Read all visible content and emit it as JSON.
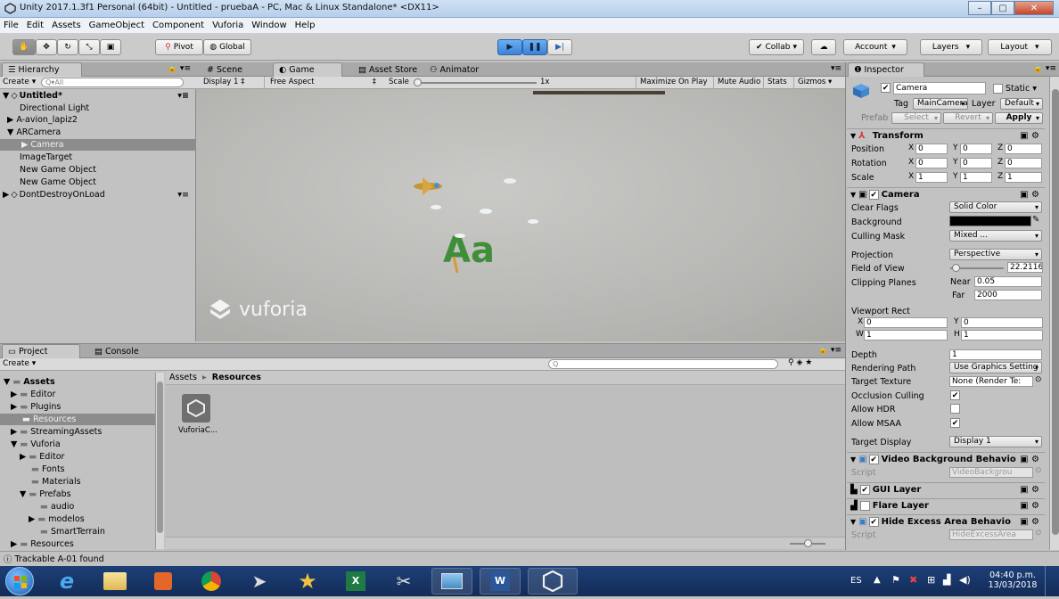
{
  "window": {
    "title": "Unity 2017.1.3f1 Personal (64bit) - Untitled - pruebaA - PC, Mac & Linux Standalone* <DX11>",
    "min": "–",
    "max": "▢",
    "close": "✕"
  },
  "menu": [
    "File",
    "Edit",
    "Assets",
    "GameObject",
    "Component",
    "Vuforia",
    "Window",
    "Help"
  ],
  "toolbar": {
    "pivot": "Pivot",
    "global": "Global",
    "collab": "Collab",
    "account": "Account",
    "layers": "Layers",
    "layout": "Layout"
  },
  "hierarchy": {
    "tab": "Hierarchy",
    "create": "Create",
    "search_placeholder": "Q▾All",
    "scene": "Untitled*",
    "items": [
      "Directional Light",
      "A-avion_lapiz2",
      "ARCamera",
      "Camera",
      "ImageTarget",
      "New Game Object",
      "New Game Object"
    ],
    "dont_destroy": "DontDestroyOnLoad"
  },
  "scene_tabs": {
    "scene": "Scene",
    "game": "Game",
    "asset_store": "Asset Store",
    "animator": "Animator"
  },
  "game_bar": {
    "display": "Display 1",
    "aspect": "Free Aspect",
    "scale_label": "Scale",
    "scale_value": "1x",
    "maximize": "Maximize On Play",
    "mute": "Mute Audio",
    "stats": "Stats",
    "gizmos": "Gizmos"
  },
  "game_view": {
    "logo_text": "vuforia",
    "ar_text": "Aa"
  },
  "project": {
    "tab_project": "Project",
    "tab_console": "Console",
    "create": "Create",
    "tree": [
      "Assets",
      "Editor",
      "Plugins",
      "Resources",
      "StreamingAssets",
      "Vuforia",
      "Editor",
      "Fonts",
      "Materials",
      "Prefabs",
      "audio",
      "modelos",
      "SmartTerrain",
      "Resources"
    ],
    "breadcrumb_root": "Assets",
    "breadcrumb_sep": "▸",
    "breadcrumb_current": "Resources",
    "asset_label": "VuforiaC..."
  },
  "inspector": {
    "tab": "Inspector",
    "object_name": "Camera",
    "static_label": "Static",
    "tag_label": "Tag",
    "tag_value": "MainCamera",
    "layer_label": "Layer",
    "layer_value": "Default",
    "prefab_label": "Prefab",
    "select": "Select",
    "revert": "Revert",
    "apply": "Apply",
    "transform": {
      "title": "Transform",
      "position": {
        "label": "Position",
        "x": "0",
        "y": "0",
        "z": "0"
      },
      "rotation": {
        "label": "Rotation",
        "x": "0",
        "y": "0",
        "z": "0"
      },
      "scale": {
        "label": "Scale",
        "x": "1",
        "y": "1",
        "z": "1"
      }
    },
    "camera": {
      "title": "Camera",
      "clear_flags_label": "Clear Flags",
      "clear_flags_value": "Solid Color",
      "background_label": "Background",
      "culling_mask_label": "Culling Mask",
      "culling_mask_value": "Mixed ...",
      "projection_label": "Projection",
      "projection_value": "Perspective",
      "fov_label": "Field of View",
      "fov_value": "22.2116",
      "clipping_label": "Clipping Planes",
      "near_label": "Near",
      "near_value": "0.05",
      "far_label": "Far",
      "far_value": "2000",
      "viewport_label": "Viewport Rect",
      "vx_label": "X",
      "vx": "0",
      "vy_label": "Y",
      "vy": "0",
      "vw_label": "W",
      "vw": "1",
      "vh_label": "H",
      "vh": "1",
      "depth_label": "Depth",
      "depth_value": "1",
      "rendering_path_label": "Rendering Path",
      "rendering_path_value": "Use Graphics Setting",
      "target_texture_label": "Target Texture",
      "target_texture_value": "None (Render Te:",
      "occlusion_label": "Occlusion Culling",
      "hdr_label": "Allow HDR",
      "msaa_label": "Allow MSAA",
      "target_display_label": "Target Display",
      "target_display_value": "Display 1"
    },
    "video_bg": {
      "title": "Video Background Behavio",
      "script_label": "Script",
      "script_value": "VideoBackgrou"
    },
    "gui_layer": "GUI Layer",
    "flare_layer": "Flare Layer",
    "hide_excess": {
      "title": "Hide Excess Area Behavio",
      "script_label": "Script",
      "script_value": "HideExcessArea"
    }
  },
  "status": {
    "message": "Trackable A-01 found"
  },
  "taskbar": {
    "lang": "ES",
    "time": "04:40 p.m.",
    "date": "13/03/2018"
  },
  "colors": {
    "play_blue": "#3b82d8",
    "game_bg": "#b9b9b7",
    "taskbar": "#1d3f78"
  }
}
